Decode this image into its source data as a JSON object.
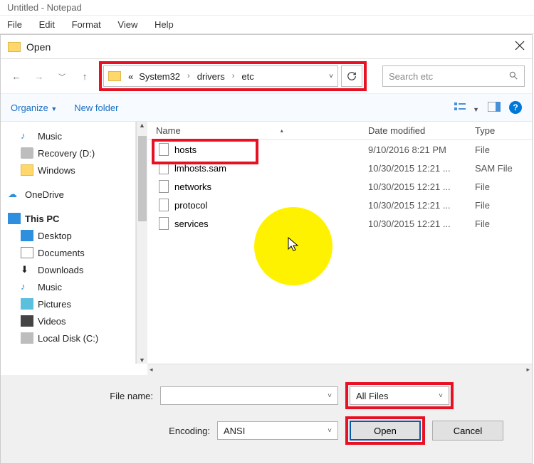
{
  "notepad": {
    "title": "Untitled - Notepad",
    "menu": [
      "File",
      "Edit",
      "Format",
      "View",
      "Help"
    ]
  },
  "dialog": {
    "title": "Open",
    "breadcrumb": {
      "sep_left": "«",
      "seg1": "System32",
      "seg2": "drivers",
      "seg3": "etc"
    },
    "search_placeholder": "Search etc",
    "toolbar": {
      "organize": "Organize",
      "newfolder": "New folder"
    },
    "tree": [
      {
        "label": "Music",
        "icon": "music",
        "indent": true
      },
      {
        "label": "Recovery (D:)",
        "icon": "drive",
        "indent": true
      },
      {
        "label": "Windows",
        "icon": "folder",
        "indent": true
      },
      {
        "label": "OneDrive",
        "icon": "onedrive",
        "indent": false,
        "sep_before": true
      },
      {
        "label": "This PC",
        "icon": "pc",
        "indent": false,
        "sep_before": true,
        "bold": true
      },
      {
        "label": "Desktop",
        "icon": "desktop",
        "indent": true
      },
      {
        "label": "Documents",
        "icon": "doc",
        "indent": true
      },
      {
        "label": "Downloads",
        "icon": "download",
        "indent": true
      },
      {
        "label": "Music",
        "icon": "music",
        "indent": true
      },
      {
        "label": "Pictures",
        "icon": "pictures",
        "indent": true
      },
      {
        "label": "Videos",
        "icon": "videos",
        "indent": true
      },
      {
        "label": "Local Disk (C:)",
        "icon": "disk",
        "indent": true
      }
    ],
    "columns": {
      "name": "Name",
      "date": "Date modified",
      "type": "Type"
    },
    "files": [
      {
        "name": "hosts",
        "date": "9/10/2016 8:21 PM",
        "type": "File",
        "hl": true
      },
      {
        "name": "lmhosts.sam",
        "date": "10/30/2015 12:21 ...",
        "type": "SAM File"
      },
      {
        "name": "networks",
        "date": "10/30/2015 12:21 ...",
        "type": "File"
      },
      {
        "name": "protocol",
        "date": "10/30/2015 12:21 ...",
        "type": "File"
      },
      {
        "name": "services",
        "date": "10/30/2015 12:21 ...",
        "type": "File"
      }
    ],
    "labels": {
      "filename": "File name:",
      "encoding": "Encoding:"
    },
    "filename_value": "",
    "filetype_value": "All Files",
    "encoding_value": "ANSI",
    "buttons": {
      "open": "Open",
      "cancel": "Cancel"
    }
  },
  "colors": {
    "accent_red": "#e81123",
    "highlight_yellow": "#fff200",
    "link_blue": "#1a6fc4"
  }
}
